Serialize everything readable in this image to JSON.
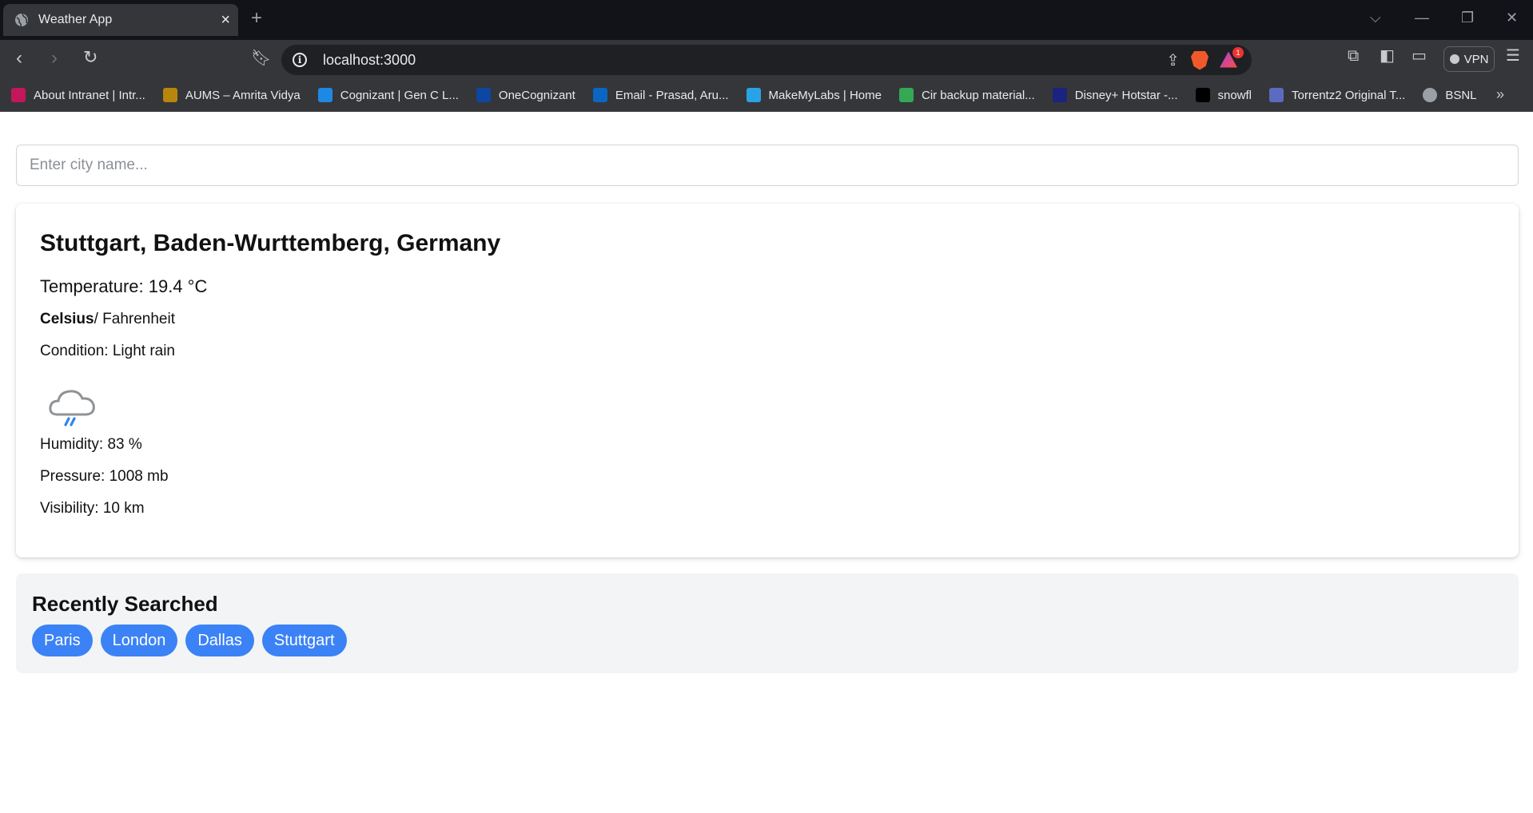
{
  "browser": {
    "tab_title": "Weather App",
    "url": "localhost:3000",
    "rewards_badge": "1",
    "vpn_label": "VPN",
    "bookmarks": [
      {
        "label": "About Intranet | Intr...",
        "icon": "intranet-icon",
        "color": "#c2185b"
      },
      {
        "label": "AUMS – Amrita Vidya",
        "icon": "amrita-icon",
        "color": "#b8860b"
      },
      {
        "label": "Cognizant | Gen C L...",
        "icon": "cognizant-icon",
        "color": "#1e88e5"
      },
      {
        "label": "OneCognizant",
        "icon": "onecognizant-icon",
        "color": "#0d47a1"
      },
      {
        "label": "Email - Prasad, Aru...",
        "icon": "outlook-icon",
        "color": "#0a66c2"
      },
      {
        "label": "MakeMyLabs | Home",
        "icon": "makemylabs-icon",
        "color": "#29a3e6"
      },
      {
        "label": "Cir backup material...",
        "icon": "drive-icon",
        "color": "#34a853"
      },
      {
        "label": "Disney+ Hotstar -...",
        "icon": "hotstar-icon",
        "color": "#1a237e"
      },
      {
        "label": "snowfl",
        "icon": "snowfl-icon",
        "color": "#000000"
      },
      {
        "label": "Torrentz2 Original T...",
        "icon": "torrentz-icon",
        "color": "#5c6bc0"
      },
      {
        "label": "BSNL",
        "icon": "globe-icon",
        "color": "#9aa0a6"
      }
    ]
  },
  "search": {
    "placeholder": "Enter city name...",
    "value": ""
  },
  "weather": {
    "location": "Stuttgart, Baden-Wurttemberg, Germany",
    "temperature": "Temperature: 19.4 °C",
    "unit_celsius": "Celsius",
    "unit_separator": "/ ",
    "unit_fahrenheit": "Fahrenheit",
    "condition": "Condition: Light rain",
    "condition_icon": "light-rain-cloud-icon",
    "humidity": "Humidity: 83 %",
    "pressure": "Pressure: 1008 mb",
    "visibility": "Visibility: 10 km"
  },
  "recent": {
    "title": "Recently Searched",
    "cities": [
      "Paris",
      "London",
      "Dallas",
      "Stuttgart"
    ]
  },
  "colors": {
    "chip_blue": "#3b82f6",
    "recent_bg": "#f3f4f6",
    "chrome_dark": "#35363a"
  }
}
